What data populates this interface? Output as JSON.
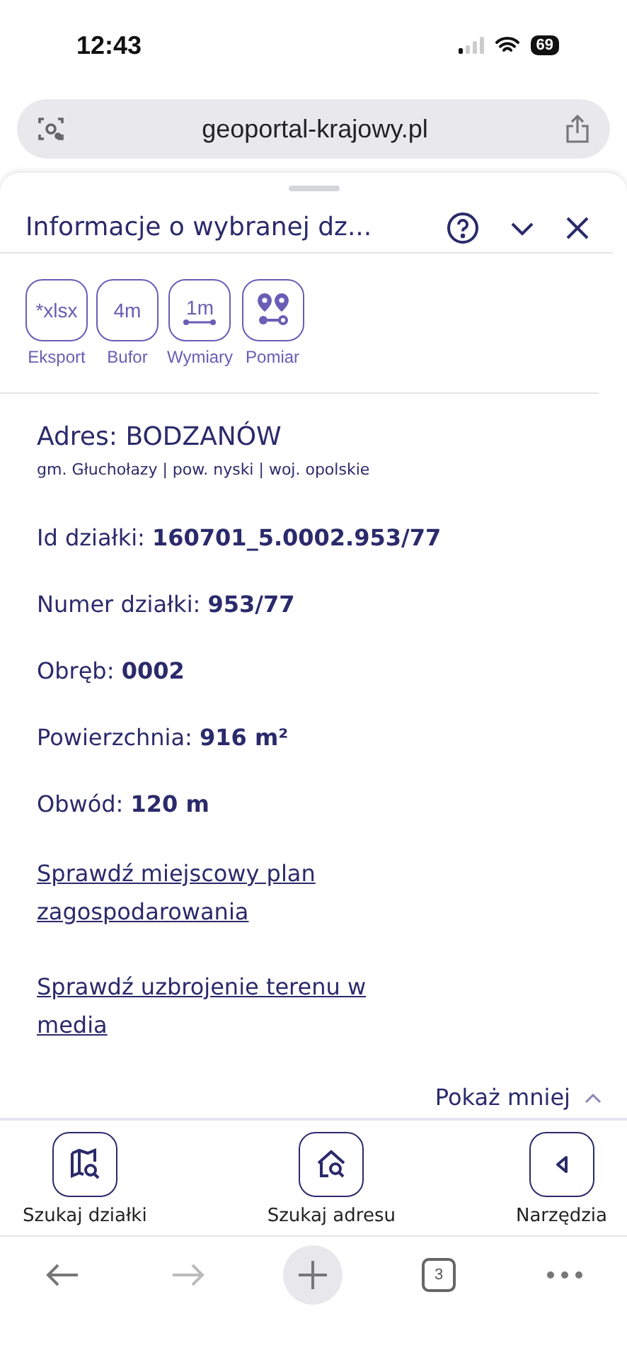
{
  "status_bar": {
    "time": "12:43",
    "battery": "69"
  },
  "browser": {
    "url": "geoportal-krajowy.pl",
    "tab_count": "3"
  },
  "panel": {
    "title": "Informacje o wybranej dz...",
    "tools": [
      {
        "kind": "text",
        "glyph": "*xlsx",
        "label": "Eksport"
      },
      {
        "kind": "text",
        "glyph": "4m",
        "label": "Bufor"
      },
      {
        "kind": "ruler",
        "glyph": "1m",
        "label": "Wymiary"
      },
      {
        "kind": "pins",
        "label": "Pomiar"
      }
    ],
    "address": {
      "label": "Adres:",
      "value": "BODZANÓW",
      "subtitle": "gm. Głuchołazy | pow. nyski | woj. opolskie"
    },
    "fields": [
      {
        "label": "Id działki:",
        "value": "160701_5.0002.953/77"
      },
      {
        "label": "Numer działki:",
        "value": "953/77"
      },
      {
        "label": "Obręb:",
        "value": "0002"
      },
      {
        "label": "Powierzchnia:",
        "value": "916 m²"
      },
      {
        "label": "Obwód:",
        "value": "120 m"
      }
    ],
    "links": [
      "Sprawdź miejscowy plan zagospodarowania",
      "Sprawdź uzbrojenie terenu w media"
    ],
    "toggle": "Pokaż mniej"
  },
  "bottom_nav": [
    {
      "kind": "map",
      "label": "Szukaj działki"
    },
    {
      "kind": "house",
      "label": "Szukaj adresu"
    },
    {
      "kind": "tools",
      "label": "Narzędzia"
    }
  ]
}
